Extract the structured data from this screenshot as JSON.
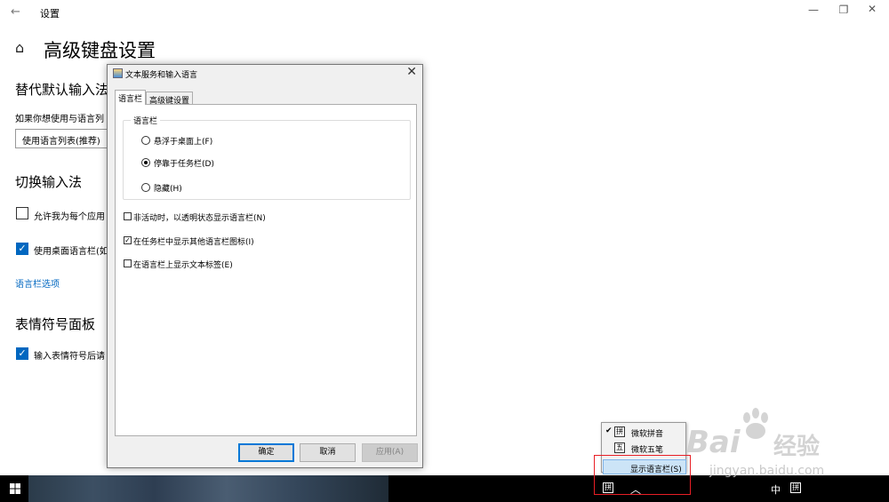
{
  "settings": {
    "title": "设置",
    "page_title": "高级键盘设置",
    "sections": {
      "override": {
        "heading": "替代默认输入法",
        "desc": "如果你想使用与语言列",
        "combo_value": "使用语言列表(推荐)"
      },
      "switch": {
        "heading": "切换输入法",
        "option1": "允许我为每个应用",
        "option2": "使用桌面语言栏(如",
        "link": "语言栏选项"
      },
      "emoji": {
        "heading": "表情符号面板",
        "option1": "输入表情符号后请"
      }
    }
  },
  "dialog": {
    "title": "文本服务和输入语言",
    "tabs": [
      "语言栏",
      "高级键设置"
    ],
    "group_label": "语言栏",
    "radios": [
      "悬浮于桌面上(F)",
      "停靠于任务栏(D)",
      "隐藏(H)"
    ],
    "checkboxes": [
      "非活动时，以透明状态显示语言栏(N)",
      "在任务栏中显示其他语言栏图标(I)",
      "在语言栏上显示文本标签(E)"
    ],
    "buttons": {
      "ok": "确定",
      "cancel": "取消",
      "apply": "应用(A)"
    }
  },
  "popup": {
    "items": [
      {
        "box": "拼",
        "label": "微软拼音",
        "checked": true
      },
      {
        "box": "五",
        "label": "微软五笔",
        "checked": false
      }
    ],
    "show_bar": "显示语言栏(S)"
  },
  "taskbar": {
    "ime_icon": "拼",
    "lang": "中",
    "tray_ime": "拼"
  },
  "watermark": {
    "brand": "Bai",
    "brand2": "经验",
    "url": "jingyan.baidu.com"
  }
}
